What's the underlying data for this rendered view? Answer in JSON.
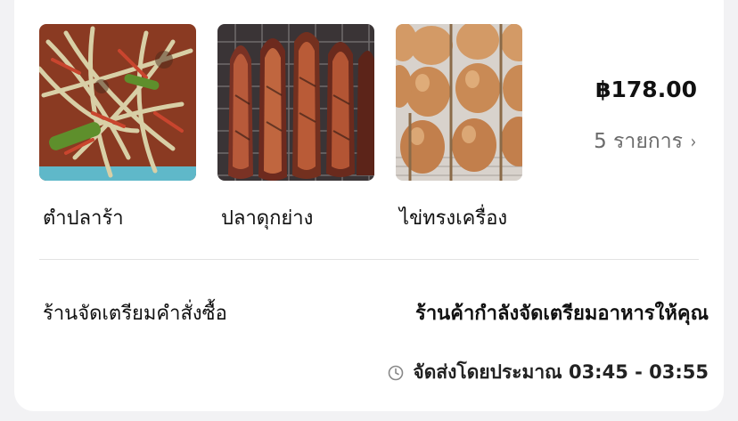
{
  "order": {
    "items": [
      {
        "name": "ตำปลาร้า",
        "image": "papaya-salad-photo"
      },
      {
        "name": "ปลาดุกย่าง",
        "image": "grilled-catfish-photo"
      },
      {
        "name": "ไข่ทรงเครื่อง",
        "image": "grilled-egg-skewer-photo"
      }
    ],
    "total_price": "฿178.00",
    "item_count_label": "5 รายการ",
    "chevron_icon": "chevron-right-icon"
  },
  "status": {
    "label": "ร้านจัดเตรียมคำสั่งซื้อ",
    "text": "ร้านค้ากำลังจัดเตรียมอาหารให้คุณ",
    "eta_icon": "clock-icon",
    "eta_text": "จัดส่งโดยประมาณ 03:45 - 03:55"
  }
}
